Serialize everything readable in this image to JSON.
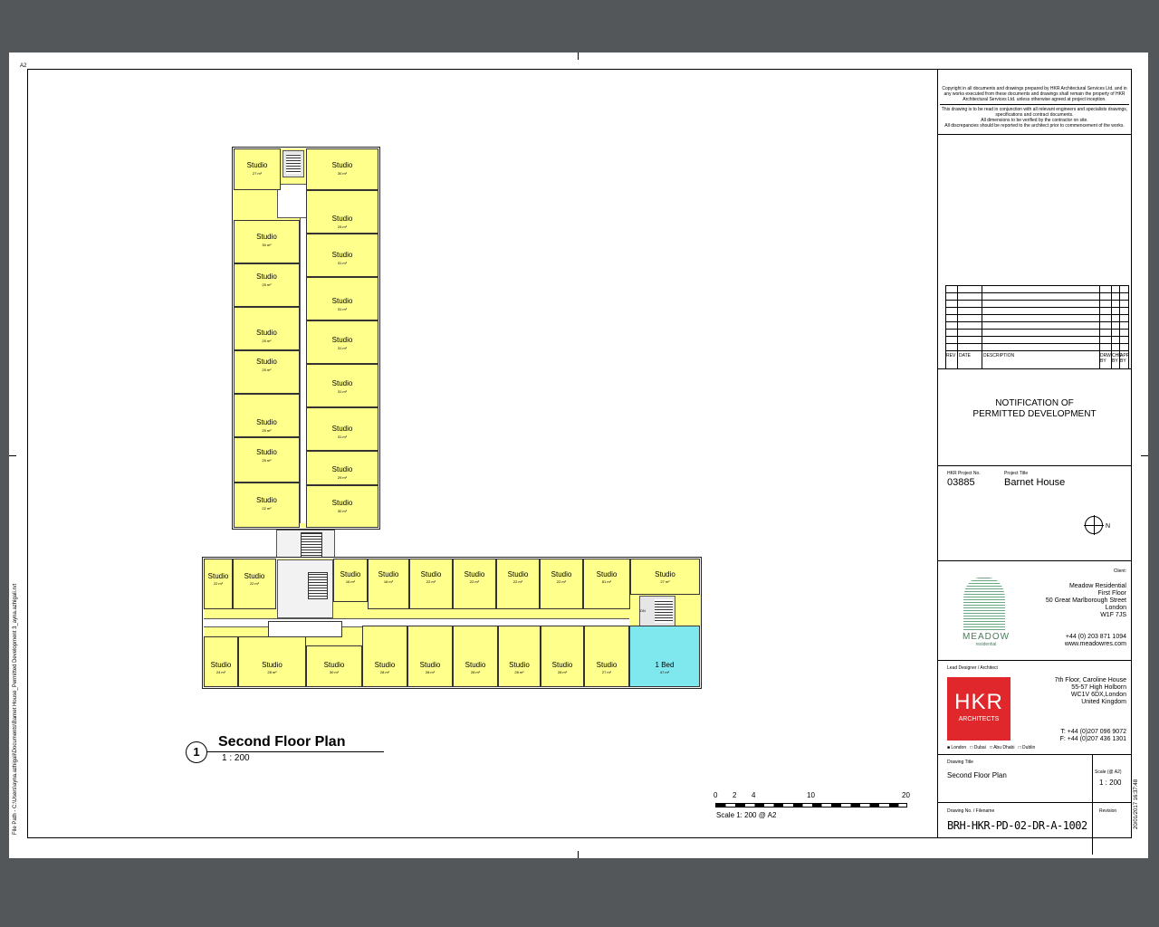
{
  "sheet": {
    "size_label": "A2",
    "file_path": "File Path - C:\\Users\\ayna.azhigali\\Documents\\Barnet House_Permitted Development 3_ayna.azhigali.rvt",
    "timestamp": "20/01/2017 16:37:48"
  },
  "notes": {
    "copyright": "Copyright in all documents and drawings prepared by HKR Architectural Services Ltd. and in any works executed from these documents and drawings shall remain the property of HKR Architectural Services Ltd. unless otherwise agreed at project inception.",
    "line1": "This drawing is to be read in conjunction with all relevant engineers and specialists drawings, specifications and contract documents.",
    "line2": "All dimensions to be verified by the contractor on site.",
    "line3": "All discrepancies should be reported to the architect prior to commencement of the works."
  },
  "revisions": {
    "headers": [
      "REV",
      "DATE",
      "DESCRIPTION",
      "DRW BY",
      "CHK BY",
      "APP BY"
    ]
  },
  "status": {
    "line1": "NOTIFICATION OF",
    "line2": "PERMITTED DEVELOPMENT"
  },
  "project": {
    "no_label": "HKR Project No.",
    "no": "03885",
    "title_label": "Project Title",
    "title": "Barnet House",
    "north_label": "N"
  },
  "client": {
    "label": "Client:",
    "lines": [
      "Meadow Residential",
      "First Floor",
      "50 Great Marlborough Street",
      "London",
      "W1F 7JS"
    ],
    "phone": "+44 (0) 203 871 1094",
    "web": "www.meadowres.com",
    "logo_name": "MEADOW",
    "logo_sub": "residential"
  },
  "architect": {
    "label": "Lead Designer / Architect",
    "lines": [
      "7th Floor, Caroline House",
      "55-57 High Holborn",
      "WC1V 6DX,London",
      "United Kingdom"
    ],
    "tel": "T: +44 (0)207 096 9072",
    "fax": "F: +44 (0)207 436 1301",
    "logo_main": "HKR",
    "logo_sub": "ARCHITECTS",
    "offices": [
      "London",
      "Dubai",
      "Abu Dhabi",
      "Dublin"
    ]
  },
  "drawing": {
    "title_label": "Drawing Title",
    "title": "Second Floor Plan",
    "scale_label": "Scale (@ A2)",
    "scale": "1 : 200",
    "no_label": "Drawing No. / Filename",
    "no": "BRH-HKR-PD-02-DR-A-1002",
    "revision_label": "Revision"
  },
  "plan": {
    "view_no": "1",
    "view_title": "Second Floor Plan",
    "view_scale": "1 : 200",
    "scale_ticks": [
      "0",
      "2",
      "4",
      "10",
      "20"
    ],
    "scale_note": "Scale 1: 200 @ A2",
    "north_wing": [
      {
        "name": "Studio",
        "area": "27 m²"
      },
      {
        "name": "Studio",
        "area": "30 m²"
      },
      {
        "name": "Studio",
        "area": "25 m²"
      },
      {
        "name": "Studio",
        "area": "30 m²"
      },
      {
        "name": "Studio",
        "area": "31 m²"
      },
      {
        "name": "Studio",
        "area": "25 m²"
      },
      {
        "name": "Studio",
        "area": "31 m²"
      },
      {
        "name": "Studio",
        "area": "25 m²"
      },
      {
        "name": "Studio",
        "area": "31 m²"
      },
      {
        "name": "Studio",
        "area": "25 m²"
      },
      {
        "name": "Studio",
        "area": "31 m²"
      },
      {
        "name": "Studio",
        "area": "25 m²"
      },
      {
        "name": "Studio",
        "area": "31 m²"
      },
      {
        "name": "Studio",
        "area": "25 m²"
      },
      {
        "name": "Studio",
        "area": "29 m²"
      },
      {
        "name": "Studio",
        "area": "22 m²"
      },
      {
        "name": "Studio",
        "area": "30 m²"
      }
    ],
    "south_top": [
      {
        "name": "Studio",
        "area": "22 m²"
      },
      {
        "name": "Studio",
        "area": "22 m²"
      },
      {
        "name": "Studio",
        "area": "16 m²"
      },
      {
        "name": "Studio",
        "area": "18 m²"
      },
      {
        "name": "Studio",
        "area": "22 m²"
      },
      {
        "name": "Studio",
        "area": "22 m²"
      },
      {
        "name": "Studio",
        "area": "22 m²"
      },
      {
        "name": "Studio",
        "area": "22 m²"
      },
      {
        "name": "Studio",
        "area": "81 m²"
      },
      {
        "name": "Studio",
        "area": "27 m²"
      }
    ],
    "south_bottom": [
      {
        "name": "Studio",
        "area": "24 m²"
      },
      {
        "name": "Studio",
        "area": "28 m²"
      },
      {
        "name": "Studio",
        "area": "30 m²"
      },
      {
        "name": "Studio",
        "area": "28 m²"
      },
      {
        "name": "Studio",
        "area": "28 m²"
      },
      {
        "name": "Studio",
        "area": "28 m²"
      },
      {
        "name": "Studio",
        "area": "28 m²"
      },
      {
        "name": "Studio",
        "area": "28 m²"
      },
      {
        "name": "Studio",
        "area": "27 m²"
      },
      {
        "name": "1 Bed",
        "area": "47 m²"
      }
    ],
    "stair_label": "DN"
  },
  "colors": {
    "studio": "#ffff8c",
    "one_bed": "#7fe8ef",
    "hkr_red": "#e0272b",
    "meadow_green": "#3a8a5a"
  }
}
